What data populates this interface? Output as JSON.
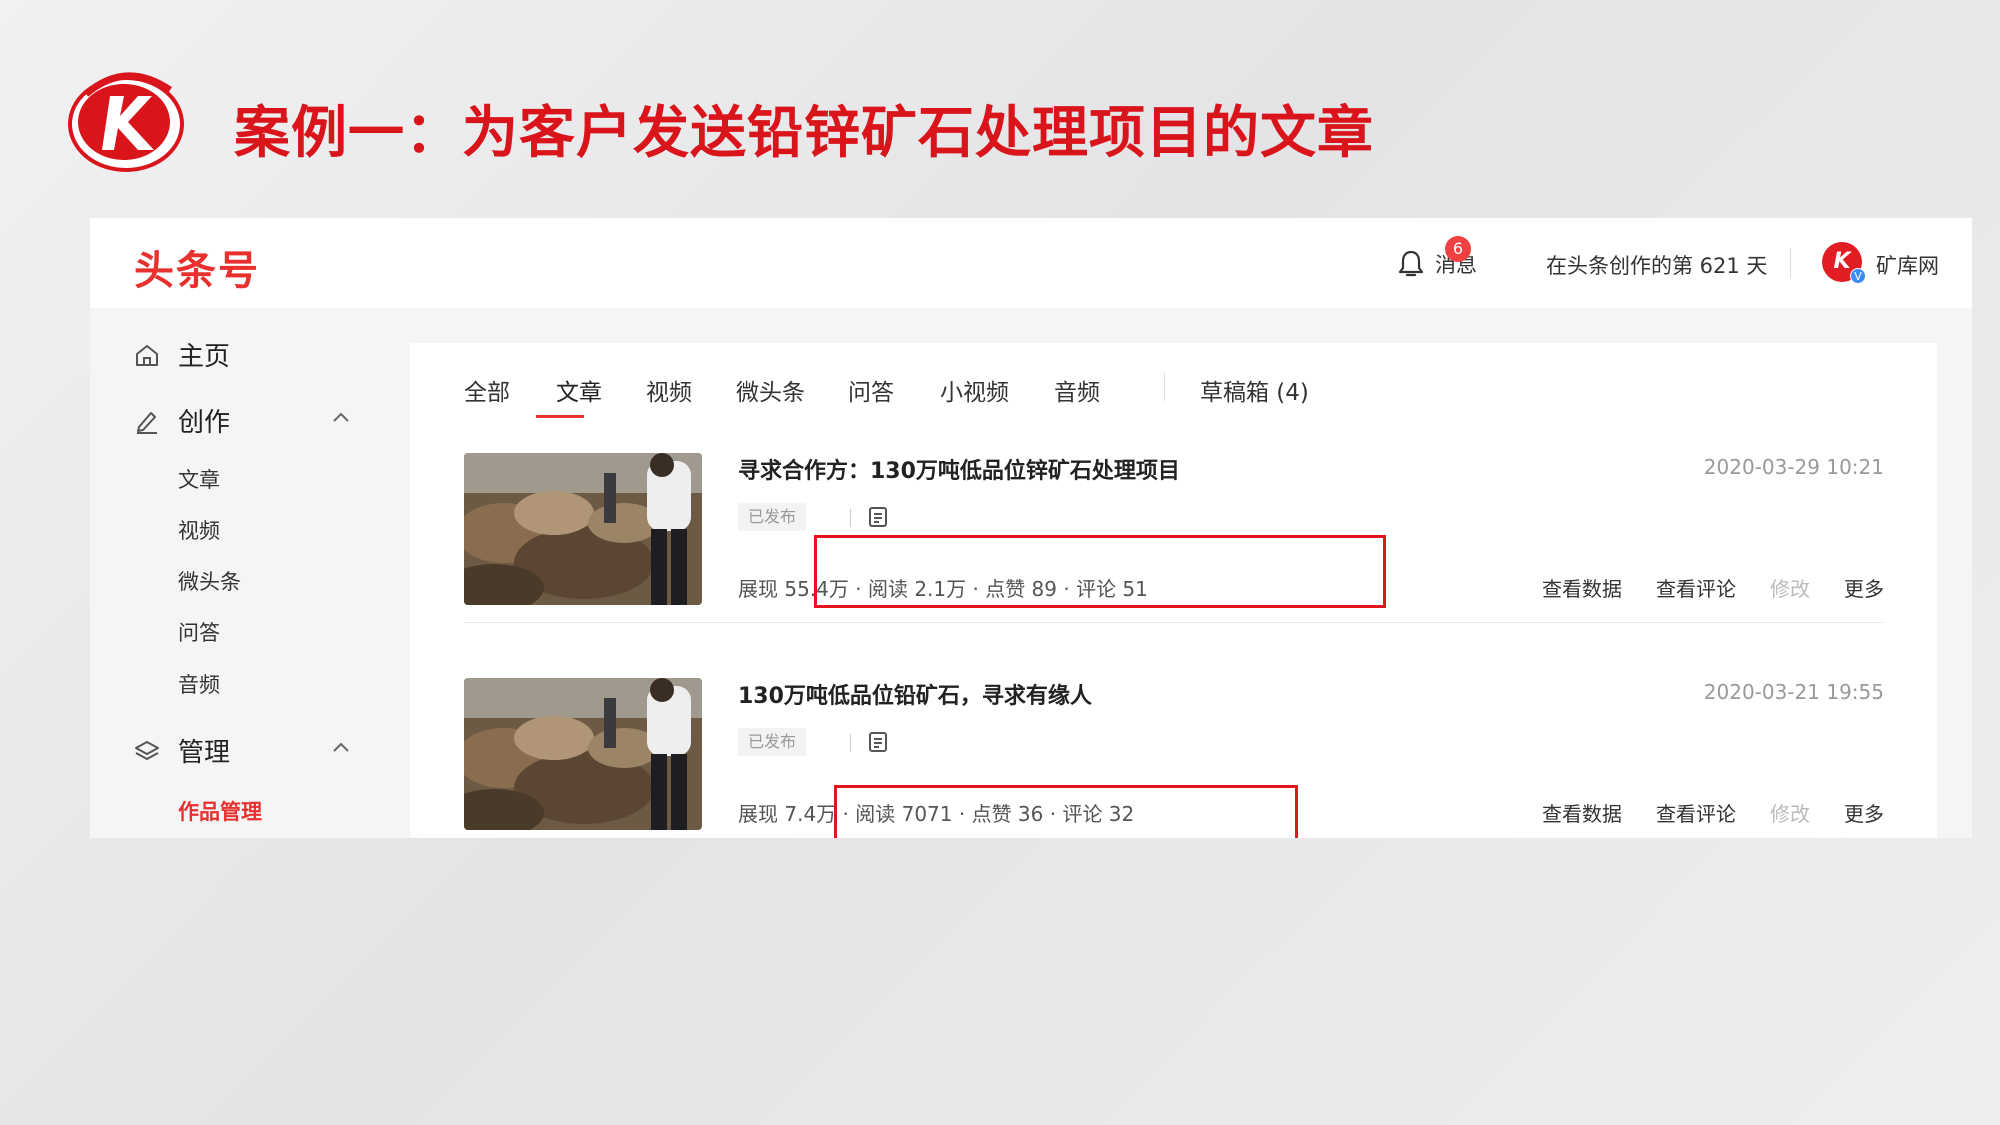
{
  "slide": {
    "title": "案例一：为客户发送铅锌矿石处理项目的文章",
    "brand_color": "#d9141b"
  },
  "topbar": {
    "brand": "头条号",
    "messages_label": "消息",
    "messages_badge": "6",
    "days_text": "在头条创作的第 621 天",
    "user_name": "矿库网",
    "avatar_letter": "K",
    "verified_mark": "V"
  },
  "sidebar": {
    "home": "主页",
    "create": "创作",
    "create_items": [
      "文章",
      "视频",
      "微头条",
      "问答",
      "音频"
    ],
    "manage": "管理",
    "manage_items": [
      "作品管理"
    ],
    "active_color": "#e8302e"
  },
  "tabs": {
    "items": [
      "全部",
      "文章",
      "视频",
      "微头条",
      "问答",
      "小视频",
      "音频"
    ],
    "active": "文章",
    "drafts": "草稿箱 (4)"
  },
  "articles": [
    {
      "title": "寻求合作方：130万吨低品位锌矿石处理项目",
      "date": "2020-03-29 10:21",
      "status": "已发布",
      "stats": "展现 55.4万 · 阅读 2.1万 · 点赞 89 · 评论 51",
      "actions": {
        "data": "查看数据",
        "comments": "查看评论",
        "edit": "修改",
        "more": "更多"
      }
    },
    {
      "title": "130万吨低品位铅矿石，寻求有缘人",
      "date": "2020-03-21 19:55",
      "status": "已发布",
      "stats": "展现 7.4万 · 阅读 7071 · 点赞 36 · 评论 32",
      "actions": {
        "data": "查看数据",
        "comments": "查看评论",
        "edit": "修改",
        "more": "更多"
      }
    }
  ]
}
